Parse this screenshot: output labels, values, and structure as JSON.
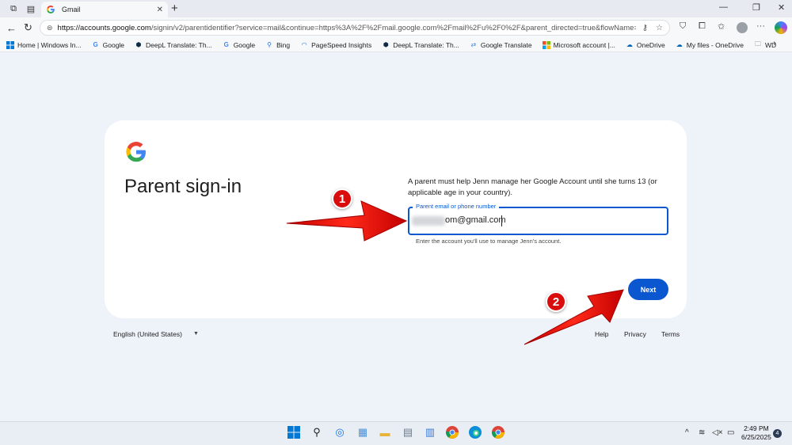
{
  "browser": {
    "tab_title": "Gmail",
    "tab_close": "✕",
    "new_tab": "+",
    "url_host": "https://accounts.google.com",
    "url_rest": "/signin/v2/parentidentifier?service=mail&continue=https%3A%2F%2Fmail.google.com%2Fmail%2Fu%2F0%2F&parent_directed=true&flowName=Glif...",
    "bookmarks": [
      {
        "label": "Home | Windows In...",
        "icon": "windows-icon"
      },
      {
        "label": "Google",
        "icon": "google-icon"
      },
      {
        "label": "DeepL Translate: Th...",
        "icon": "deepl-icon"
      },
      {
        "label": "Google",
        "icon": "google-icon"
      },
      {
        "label": "Bing",
        "icon": "bing-search-icon"
      },
      {
        "label": "PageSpeed Insights",
        "icon": "pagespeed-icon"
      },
      {
        "label": "DeepL Translate: Th...",
        "icon": "deepl-icon"
      },
      {
        "label": "Google Translate",
        "icon": "google-translate-icon"
      },
      {
        "label": "Microsoft account |...",
        "icon": "microsoft-icon"
      },
      {
        "label": "OneDrive",
        "icon": "onedrive-icon"
      },
      {
        "label": "My files - OneDrive",
        "icon": "onedrive-icon"
      },
      {
        "label": "WD",
        "icon": "folder-icon"
      }
    ]
  },
  "signin": {
    "heading": "Parent sign-in",
    "description": "A parent must help Jenn manage her Google Account until she turns 13 (or applicable age in your country).",
    "field_label": "Parent email or phone number",
    "field_value": "om@gmail.com",
    "helper": "Enter the account you'll use to manage Jenn's account.",
    "next_label": "Next"
  },
  "annotations": {
    "step1": "1",
    "step2": "2",
    "color": "#e8150f"
  },
  "footer": {
    "language": "English (United States)",
    "help": "Help",
    "privacy": "Privacy",
    "terms": "Terms"
  },
  "taskbar": {
    "time": "2:49 PM",
    "date": "6/25/2025",
    "notifications": "4"
  },
  "colors": {
    "accent": "#0b57d0",
    "page_bg": "#eef2f9"
  }
}
